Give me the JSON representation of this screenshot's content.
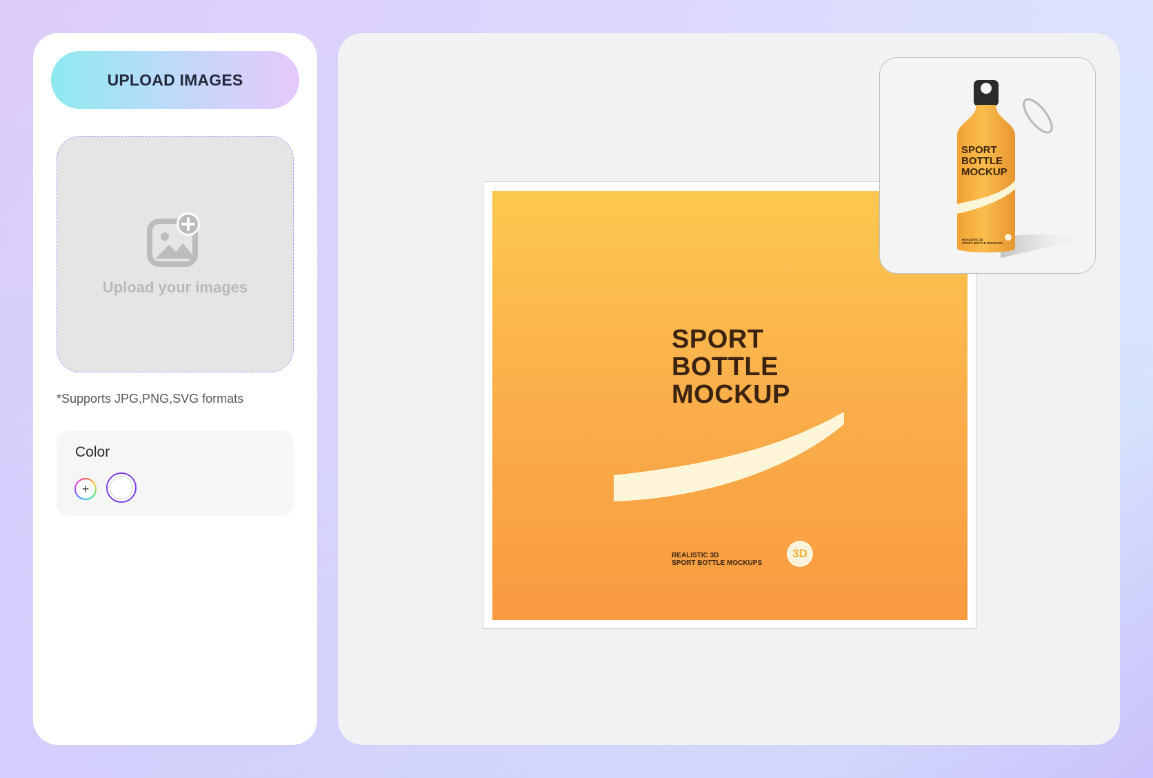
{
  "left_panel": {
    "upload_button_label": "UPLOAD IMAGES",
    "dropzone_text": "Upload your images",
    "supports_note": "*Supports JPG,PNG,SVG formats",
    "color": {
      "label": "Color",
      "add_symbol": "+",
      "swatches": [
        "#ffffff"
      ],
      "selected_swatch": "#ffffff",
      "selected_ring_color": "#7c3aed"
    }
  },
  "canvas": {
    "artwork": {
      "title_lines": [
        "SPORT",
        "BOTTLE",
        "MOCKUP"
      ],
      "subtitle_lines": [
        "REALISTIC 3D",
        "SPORT BOTTLE MOCKUPS"
      ],
      "badge": "3D",
      "gradient": [
        "#fdc84f",
        "#f99a40"
      ]
    },
    "preview": {
      "label_lines": [
        "SPORT",
        "BOTTLE",
        "MOCKUP"
      ],
      "sub_lines": [
        "REALISTIC 3D",
        "SPORT BOTTLE MOCKUPS"
      ]
    }
  },
  "icons": {
    "dropzone": "add-image-icon",
    "color_add": "plus-icon"
  }
}
